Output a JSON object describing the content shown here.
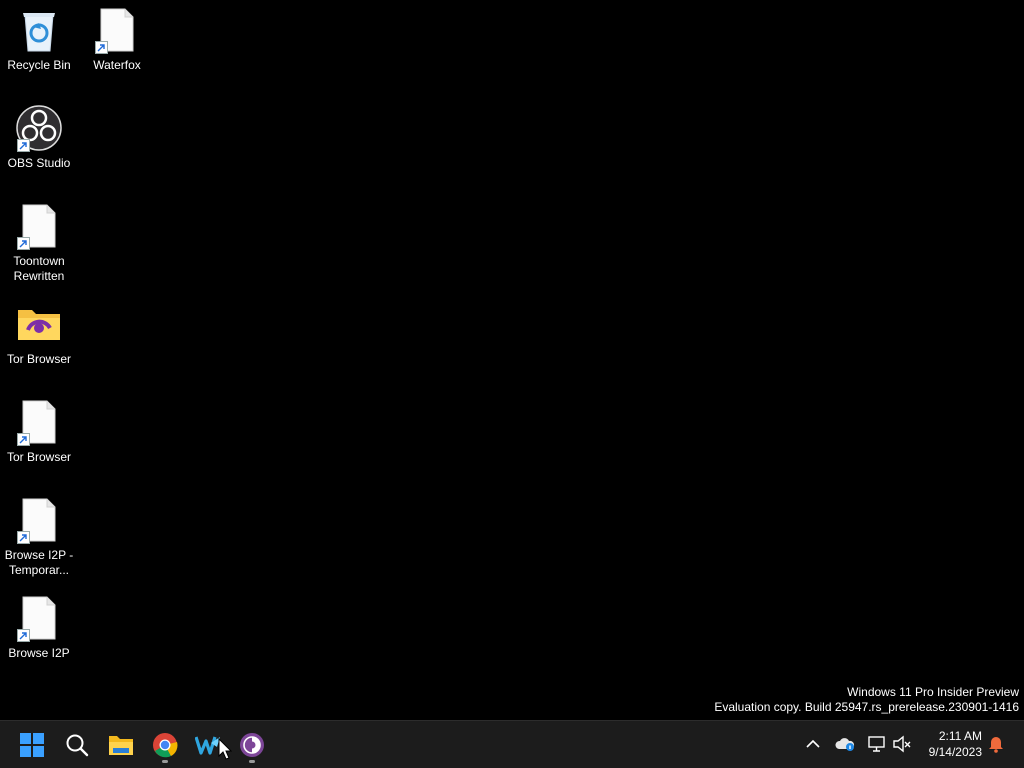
{
  "desktop": {
    "icons": [
      {
        "label": "Recycle Bin",
        "icon": "recycle-bin-icon"
      },
      {
        "label": "Waterfox",
        "icon": "blank-file-icon"
      },
      {
        "label": "OBS Studio",
        "icon": "obs-studio-icon"
      },
      {
        "label": "Toontown Rewritten",
        "icon": "blank-file-icon"
      },
      {
        "label": "Tor Browser",
        "icon": "tor-folder-icon"
      },
      {
        "label": "Tor Browser",
        "icon": "blank-file-icon"
      },
      {
        "label": "Browse I2P - Temporar...",
        "icon": "blank-file-icon"
      },
      {
        "label": "Browse I2P",
        "icon": "blank-file-icon"
      }
    ]
  },
  "watermark": {
    "line1": "Windows 11 Pro Insider Preview",
    "line2": "Evaluation copy. Build 25947.rs_prerelease.230901-1416"
  },
  "taskbar": {
    "apps": [
      "start-icon",
      "search-icon",
      "file-explorer-icon",
      "chrome-icon",
      "waterfox-icon",
      "tor-browser-icon"
    ]
  },
  "tray": {
    "time": "2:11 AM",
    "date": "9/14/2023",
    "icons": [
      "chevron-up-icon",
      "onedrive-icon",
      "network-icon",
      "volume-muted-icon",
      "notification-bell-icon"
    ]
  },
  "colors": {
    "taskbar": "#1c1c1c",
    "accent": "#0a84ff",
    "notification": "#f06a3c"
  }
}
